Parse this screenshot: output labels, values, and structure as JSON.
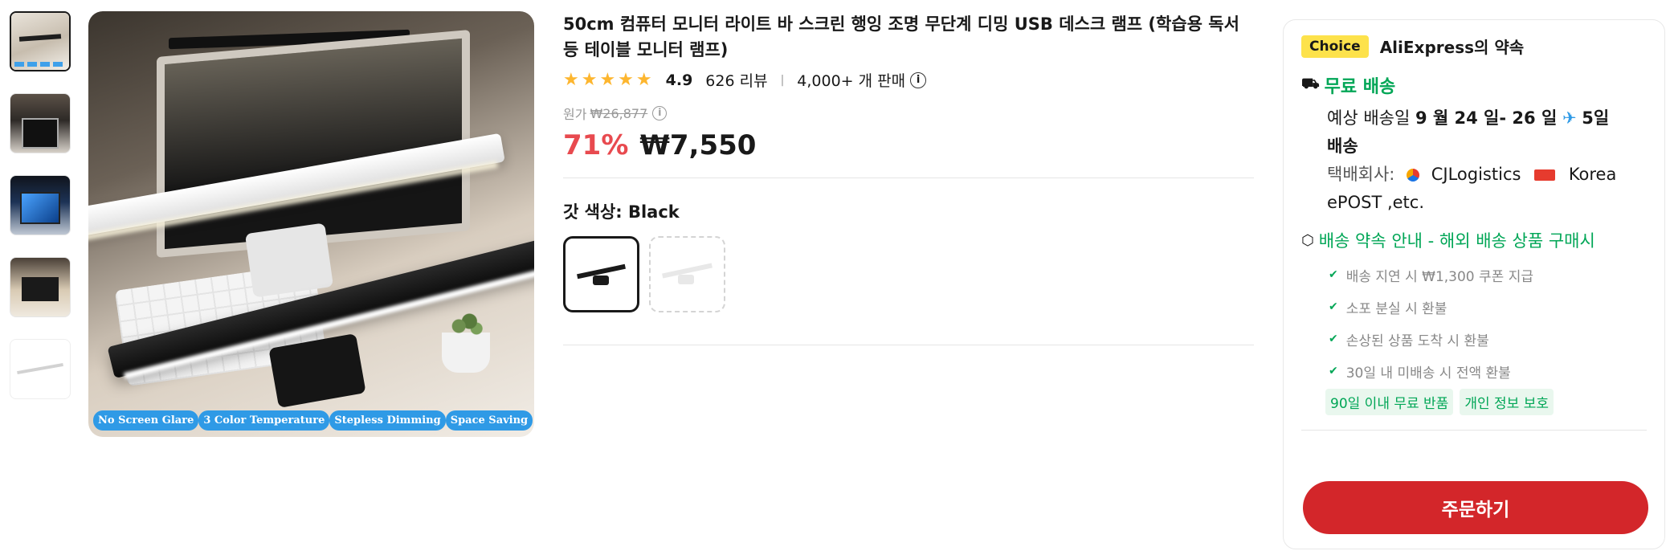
{
  "thumbnails": [
    {
      "alt": "thumbnail-1"
    },
    {
      "alt": "thumbnail-2"
    },
    {
      "alt": "thumbnail-3"
    },
    {
      "alt": "thumbnail-4"
    },
    {
      "alt": "thumbnail-5"
    }
  ],
  "main_image": {
    "badges": [
      "No Screen Glare",
      "3 Color Temperature",
      "Stepless Dimming",
      "Space Saving"
    ]
  },
  "product": {
    "title": "50cm 컴퓨터 모니터 라이트 바 스크린 행잉 조명 무단계 디밍 USB 데스크 램프 (학습용 독서등 테이블 모니터 램프)",
    "stars": "★★★★★",
    "rating": "4.9",
    "reviews": "626 리뷰",
    "sold": "4,000+ 개 판매",
    "info_icon": "i",
    "original_label": "원가",
    "original_price": "₩26,877",
    "discount": "71%",
    "price": "₩7,550",
    "color_label": "갓 색상: Black",
    "colors": [
      "Black",
      "White"
    ]
  },
  "panel": {
    "choice_badge": "Choice",
    "promise_title": "AliExpress의 약속",
    "shipping_title": "무료 배송",
    "delivery_prefix": "예상 배송일",
    "delivery_date": "9 월 24 일- 26 일",
    "plane_icon": "✈",
    "delivery_days": "5일",
    "delivery_suffix": "배송",
    "courier_label": "택배회사:",
    "courier_1": "CJLogistics",
    "courier_2": "Korea ePOST ,etc.",
    "guarantee_title": "배송 약속 안내 - 해외 배송 상품 구매시",
    "guarantee_items": [
      "배송 지연 시 ₩1,300 쿠폰 지급",
      "소포 분실 시 환불",
      "손상된 상품 도착 시 환불",
      "30일 내 미배송 시 전액 환불"
    ],
    "tags": [
      "90일 이내 무료 반품",
      "개인 정보 보호"
    ],
    "order_button": "주문하기"
  },
  "icons": {
    "truck": "⛟",
    "box": "⬡",
    "check": "✔"
  },
  "colors": {
    "accent_red": "#d3262a",
    "discount_red": "#e84a4f",
    "green": "#00a656",
    "choice_yellow": "#fde24b",
    "badge_blue": "#2f9ae6",
    "star": "#fdb62f"
  }
}
